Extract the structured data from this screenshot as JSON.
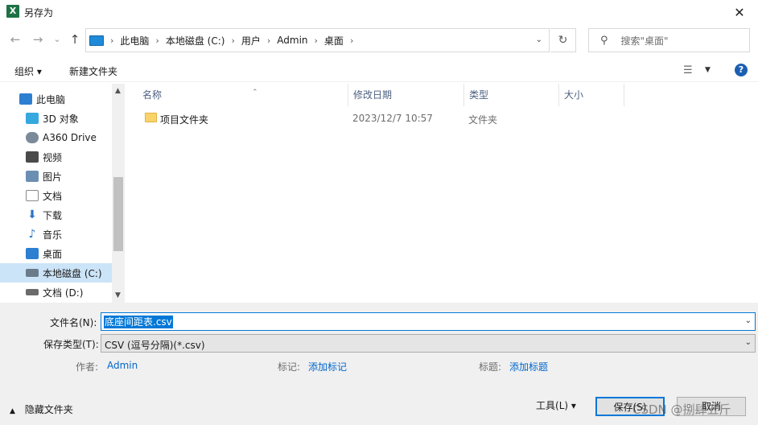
{
  "window": {
    "title": "另存为",
    "app_icon_letter": "X",
    "close_glyph": "✕"
  },
  "nav": {
    "back_glyph": "←",
    "forward_glyph": "→",
    "recent_glyph": "⌄",
    "up_glyph": "↑",
    "breadcrumb": [
      "此电脑",
      "本地磁盘 (C:)",
      "用户",
      "Admin",
      "桌面"
    ],
    "refresh_glyph": "↻",
    "search_placeholder": "搜索\"桌面\""
  },
  "toolbar": {
    "organize_label": "组织 ▾",
    "new_folder_label": "新建文件夹",
    "help_glyph": "?"
  },
  "nav_pane": {
    "items": [
      {
        "label": "此电脑",
        "icon": "computer-icon",
        "color": "#2d7fd1"
      },
      {
        "label": "3D 对象",
        "icon": "cube-3d-icon",
        "color": "#35a8e0"
      },
      {
        "label": "A360 Drive",
        "icon": "cloud-drive-icon",
        "color": "#7a8a99"
      },
      {
        "label": "视频",
        "icon": "film-icon",
        "color": "#4a4a4a"
      },
      {
        "label": "图片",
        "icon": "picture-icon",
        "color": "#6b8fb3"
      },
      {
        "label": "文档",
        "icon": "document-icon",
        "color": "#8a8a8a"
      },
      {
        "label": "下载",
        "icon": "download-arrow-icon",
        "color": "#2b74c9"
      },
      {
        "label": "音乐",
        "icon": "music-note-icon",
        "color": "#2b74c9"
      },
      {
        "label": "桌面",
        "icon": "desktop-icon",
        "color": "#2d7fd1"
      },
      {
        "label": "本地磁盘 (C:)",
        "icon": "windows-drive-icon",
        "color": "#6b7b8c",
        "selected": true
      },
      {
        "label": "文档 (D:)",
        "icon": "drive-icon",
        "color": "#6b6b6b"
      }
    ]
  },
  "file_list": {
    "columns": [
      "名称",
      "修改日期",
      "类型",
      "大小"
    ],
    "rows": [
      {
        "name": "项目文件夹",
        "modified": "2023/12/7 10:57",
        "type": "文件夹",
        "size": ""
      }
    ]
  },
  "form": {
    "filename_label": "文件名(N):",
    "filename_value": "底座间距表.csv",
    "filetype_label": "保存类型(T):",
    "filetype_value": "CSV (逗号分隔)(*.csv)",
    "author_label": "作者:",
    "author_value": "Admin",
    "tags_label": "标记:",
    "tags_value": "添加标记",
    "title_label": "标题:",
    "title_value": "添加标题",
    "hide_folders_label": "隐藏文件夹",
    "tools_label": "工具(L)   ▾",
    "save_label": "保存(S)",
    "cancel_label": "取消",
    "watermark": "CSDN @捌肆五斤"
  },
  "colors": {
    "accent": "#0078d7",
    "selection": "#cce4f7",
    "link": "#0066cc"
  }
}
